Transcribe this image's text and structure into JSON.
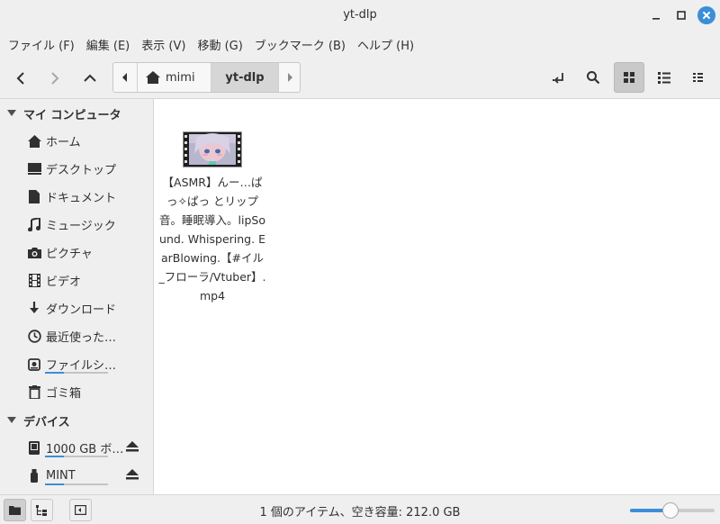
{
  "window": {
    "title": "yt-dlp"
  },
  "menu": [
    "ファイル (F)",
    "編集 (E)",
    "表示 (V)",
    "移動 (G)",
    "ブックマーク (B)",
    "ヘルプ (H)"
  ],
  "pathbar": {
    "home_label": "mimi",
    "current_label": "yt-dlp"
  },
  "sidebar": {
    "my_computer_header": "マイ コンピュータ",
    "devices_header": "デバイス",
    "items": [
      {
        "label": "ホーム",
        "icon": "home-icon"
      },
      {
        "label": "デスクトップ",
        "icon": "desktop-icon"
      },
      {
        "label": "ドキュメント",
        "icon": "document-icon"
      },
      {
        "label": "ミュージック",
        "icon": "music-icon"
      },
      {
        "label": "ピクチャ",
        "icon": "camera-icon"
      },
      {
        "label": "ビデオ",
        "icon": "film-icon"
      },
      {
        "label": "ダウンロード",
        "icon": "download-icon"
      },
      {
        "label": "最近使った…",
        "icon": "clock-icon"
      },
      {
        "label": "ファイルシ…",
        "icon": "drive-icon"
      },
      {
        "label": "ゴミ箱",
        "icon": "trash-icon"
      }
    ],
    "devices": [
      {
        "label": "1000 GB ボ…",
        "icon": "harddisk-icon"
      },
      {
        "label": "MINT",
        "icon": "usb-icon"
      }
    ],
    "filesystem_usage": 0.3,
    "device_usage": [
      0.3,
      0.3
    ]
  },
  "files": [
    {
      "name": "【ASMR】んー…ぱっ✧ぱっ とリップ音。睡眠導入。lipSound. Whispering. EarBlowing.【#イル_フローラ/Vtuber】.mp4",
      "type": "video"
    }
  ],
  "status": {
    "text": "1 個のアイテム、空き容量: 212.0 GB",
    "zoom": 0.48
  },
  "colors": {
    "accent": "#3b8ed8",
    "window_bg": "#efefef",
    "selected": "#c9c9c9"
  }
}
